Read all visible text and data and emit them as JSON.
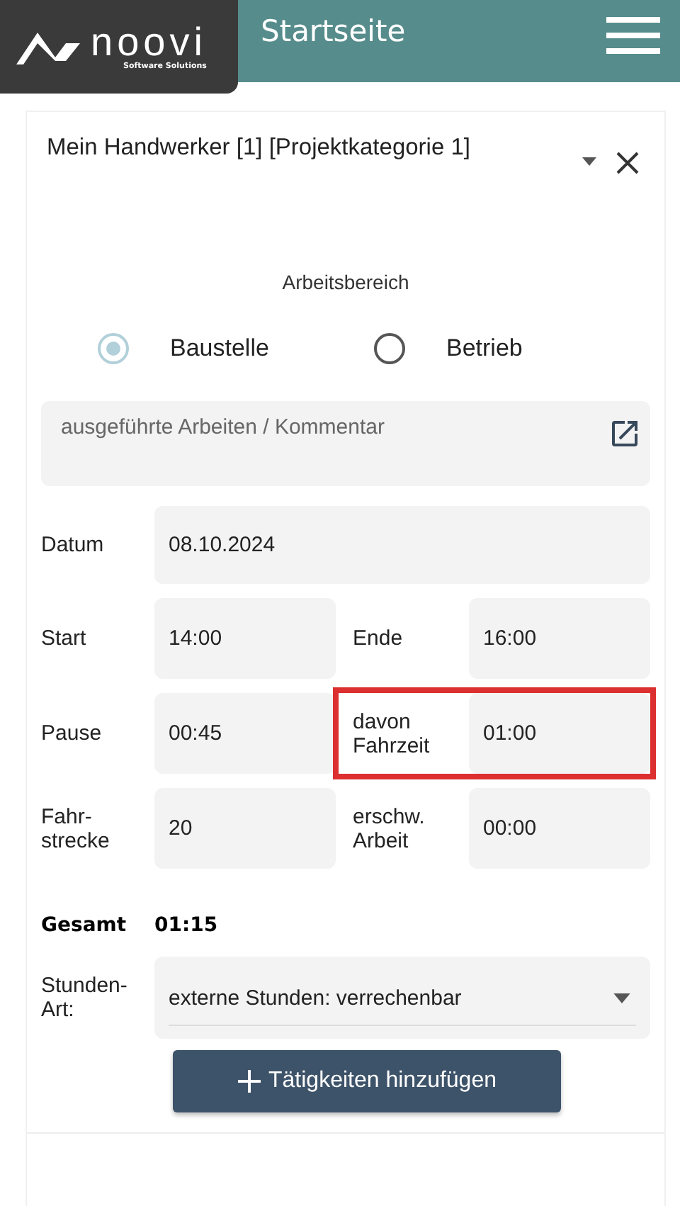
{
  "header": {
    "logo": {
      "name": "noovi",
      "tagline": "Software Solutions"
    },
    "title": "Startseite"
  },
  "card": {
    "title": "Mein Handwerker [1] [Projektkategorie 1]",
    "area": {
      "label": "Arbeitsbereich",
      "options": [
        {
          "label": "Baustelle",
          "selected": true
        },
        {
          "label": "Betrieb",
          "selected": false
        }
      ]
    },
    "comment": {
      "placeholder": "ausgeführte Arbeiten / Kommentar"
    },
    "rows": [
      {
        "kind": "single",
        "fields": [
          {
            "label": "Datum",
            "value": "08.10.2024",
            "highlighted": false
          }
        ]
      },
      {
        "kind": "pair",
        "fields": [
          {
            "label": "Start",
            "value": "14:00",
            "highlighted": false
          },
          {
            "label": "Ende",
            "value": "16:00",
            "highlighted": false
          }
        ]
      },
      {
        "kind": "pair",
        "fields": [
          {
            "label": "Pause",
            "value": "00:45",
            "highlighted": false
          },
          {
            "label": "davon Fahrzeit",
            "value": "01:00",
            "highlighted": true
          }
        ]
      },
      {
        "kind": "pair",
        "fields": [
          {
            "label": "Fahr-strecke",
            "value": "20",
            "highlighted": false
          },
          {
            "label": "erschw. Arbeit",
            "value": "00:00",
            "highlighted": false
          }
        ]
      }
    ],
    "total": {
      "label": "Gesamt",
      "value": "01:15"
    },
    "hours_type": {
      "label": "Stunden-Art:",
      "value": "externe Stunden: verrechenbar"
    },
    "add_button": "Tätigkeiten hinzufügen"
  }
}
